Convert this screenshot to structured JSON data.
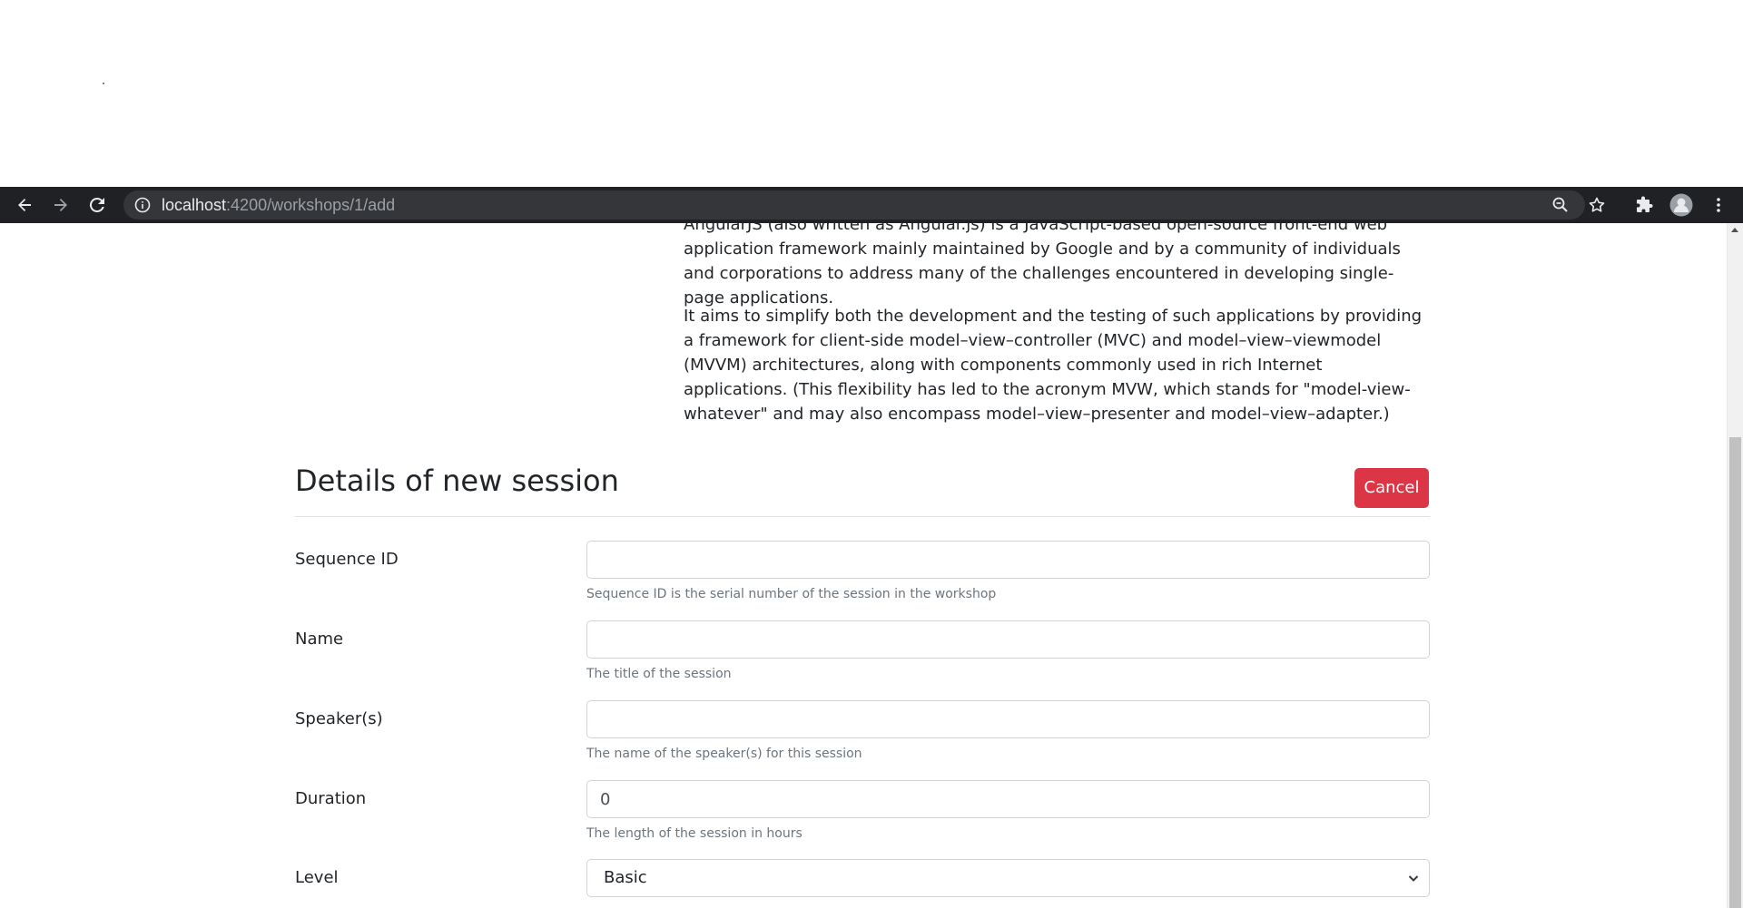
{
  "browser": {
    "url_host": "localhost",
    "url_path": ":4200/workshops/1/add",
    "icons": {
      "back": "arrow-left-icon",
      "forward": "arrow-right-icon",
      "reload": "reload-icon",
      "info": "info-icon",
      "zoom": "zoom-icon",
      "bookmark": "star-icon",
      "extensions": "puzzle-icon",
      "profile": "avatar",
      "menu": "kebab-menu-icon"
    }
  },
  "intro": {
    "p1_line1_partial": "AngularJS (also written as Angular.js) is a JavaScript-based open-source front-end web application",
    "p1_rest": "framework mainly maintained by Google and by a community of individuals and corporations to address many of the challenges encountered in developing single-page applications.",
    "p2": "It aims to simplify both the development and the testing of such applications by providing a framework for client-side model–view–controller (MVC) and model–view–viewmodel (MVVM) architectures, along with components commonly used in rich Internet applications. (This flexibility has led to the acronym MVW, which stands for \"model-view-whatever\" and may also encompass model–view–presenter and model–view–adapter.)"
  },
  "form": {
    "title": "Details of new session",
    "cancel_label": "Cancel",
    "fields": {
      "sequence_id": {
        "label": "Sequence ID",
        "value": "",
        "help": "Sequence ID is the serial number of the session in the workshop"
      },
      "name": {
        "label": "Name",
        "value": "",
        "help": "The title of the session"
      },
      "speakers": {
        "label": "Speaker(s)",
        "value": "",
        "help": "The name of the speaker(s) for this session"
      },
      "duration": {
        "label": "Duration",
        "value": "0",
        "help": "The length of the session in hours"
      },
      "level": {
        "label": "Level",
        "selected": "Basic"
      }
    }
  },
  "colors": {
    "toolbar_bg": "#202124",
    "omnibox_bg": "#35363a",
    "danger": "#dc3545",
    "text": "#212529",
    "muted": "#6c757d",
    "border": "#ced4da"
  }
}
